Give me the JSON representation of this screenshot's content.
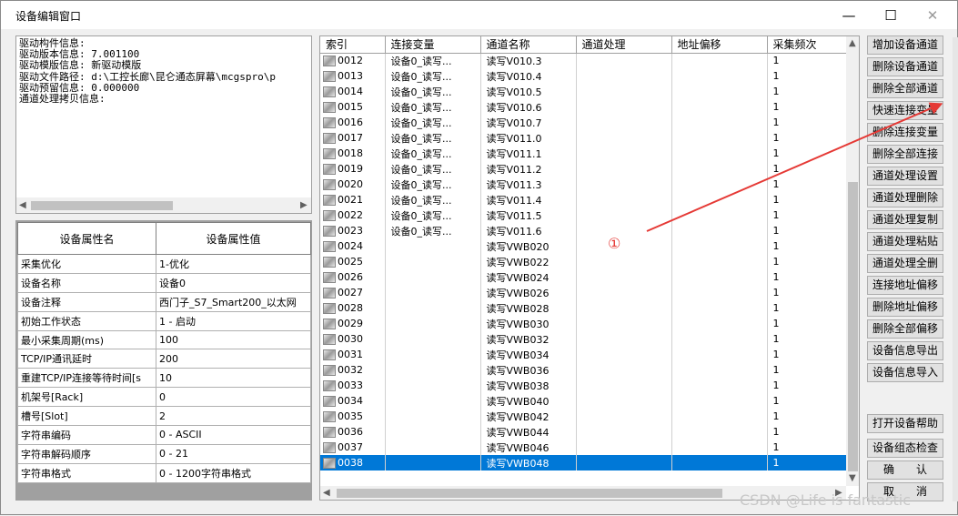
{
  "window": {
    "title": "设备编辑窗口",
    "minimize": "—",
    "maximize": "☐",
    "close": "✕"
  },
  "info": {
    "lines": [
      "驱动构件信息:",
      "驱动版本信息: 7.001100",
      "驱动模版信息: 新驱动模版",
      "驱动文件路径: d:\\工控长廊\\昆仑通态屏幕\\mcgspro\\p",
      "驱动预留信息: 0.000000",
      "通道处理拷贝信息:"
    ]
  },
  "props": {
    "headers": [
      "设备属性名",
      "设备属性值"
    ],
    "rows": [
      [
        "采集优化",
        "1-优化"
      ],
      [
        "设备名称",
        "设备0"
      ],
      [
        "设备注释",
        "西门子_S7_Smart200_以太网"
      ],
      [
        "初始工作状态",
        "1 - 启动"
      ],
      [
        "最小采集周期(ms)",
        "100"
      ],
      [
        "TCP/IP通讯延时",
        "200"
      ],
      [
        "重建TCP/IP连接等待时间[s",
        "10"
      ],
      [
        "机架号[Rack]",
        "0"
      ],
      [
        "槽号[Slot]",
        "2"
      ],
      [
        "字符串编码",
        "0 - ASCII"
      ],
      [
        "字符串解码顺序",
        "0 - 21"
      ],
      [
        "字符串格式",
        "0 - 1200字符串格式"
      ]
    ]
  },
  "grid": {
    "headers": [
      "索引",
      "连接变量",
      "通道名称",
      "通道处理",
      "地址偏移",
      "采集频次"
    ],
    "rows": [
      [
        "0012",
        "设备0_读写...",
        "读写V010.3",
        "",
        "",
        "1"
      ],
      [
        "0013",
        "设备0_读写...",
        "读写V010.4",
        "",
        "",
        "1"
      ],
      [
        "0014",
        "设备0_读写...",
        "读写V010.5",
        "",
        "",
        "1"
      ],
      [
        "0015",
        "设备0_读写...",
        "读写V010.6",
        "",
        "",
        "1"
      ],
      [
        "0016",
        "设备0_读写...",
        "读写V010.7",
        "",
        "",
        "1"
      ],
      [
        "0017",
        "设备0_读写...",
        "读写V011.0",
        "",
        "",
        "1"
      ],
      [
        "0018",
        "设备0_读写...",
        "读写V011.1",
        "",
        "",
        "1"
      ],
      [
        "0019",
        "设备0_读写...",
        "读写V011.2",
        "",
        "",
        "1"
      ],
      [
        "0020",
        "设备0_读写...",
        "读写V011.3",
        "",
        "",
        "1"
      ],
      [
        "0021",
        "设备0_读写...",
        "读写V011.4",
        "",
        "",
        "1"
      ],
      [
        "0022",
        "设备0_读写...",
        "读写V011.5",
        "",
        "",
        "1"
      ],
      [
        "0023",
        "设备0_读写...",
        "读写V011.6",
        "",
        "",
        "1"
      ],
      [
        "0024",
        "",
        "读写VWB020",
        "",
        "",
        "1"
      ],
      [
        "0025",
        "",
        "读写VWB022",
        "",
        "",
        "1"
      ],
      [
        "0026",
        "",
        "读写VWB024",
        "",
        "",
        "1"
      ],
      [
        "0027",
        "",
        "读写VWB026",
        "",
        "",
        "1"
      ],
      [
        "0028",
        "",
        "读写VWB028",
        "",
        "",
        "1"
      ],
      [
        "0029",
        "",
        "读写VWB030",
        "",
        "",
        "1"
      ],
      [
        "0030",
        "",
        "读写VWB032",
        "",
        "",
        "1"
      ],
      [
        "0031",
        "",
        "读写VWB034",
        "",
        "",
        "1"
      ],
      [
        "0032",
        "",
        "读写VWB036",
        "",
        "",
        "1"
      ],
      [
        "0033",
        "",
        "读写VWB038",
        "",
        "",
        "1"
      ],
      [
        "0034",
        "",
        "读写VWB040",
        "",
        "",
        "1"
      ],
      [
        "0035",
        "",
        "读写VWB042",
        "",
        "",
        "1"
      ],
      [
        "0036",
        "",
        "读写VWB044",
        "",
        "",
        "1"
      ],
      [
        "0037",
        "",
        "读写VWB046",
        "",
        "",
        "1"
      ],
      [
        "0038",
        "",
        "读写VWB048",
        "",
        "",
        "1"
      ]
    ],
    "selected_index": "0038",
    "selected_color": "#0078d7"
  },
  "buttons": [
    "增加设备通道",
    "删除设备通道",
    "删除全部通道",
    "快速连接变量",
    "删除连接变量",
    "删除全部连接",
    "通道处理设置",
    "通道处理删除",
    "通道处理复制",
    "通道处理粘贴",
    "通道处理全删",
    "连接地址偏移",
    "删除地址偏移",
    "删除全部偏移",
    "设备信息导出",
    "设备信息导入"
  ],
  "buttons2": [
    "打开设备帮助",
    "设备组态检查",
    "确　　认",
    "取　　消"
  ],
  "annotation": {
    "marker": "①",
    "color": "#e53935"
  },
  "watermark": "CSDN @Life is fantastic"
}
